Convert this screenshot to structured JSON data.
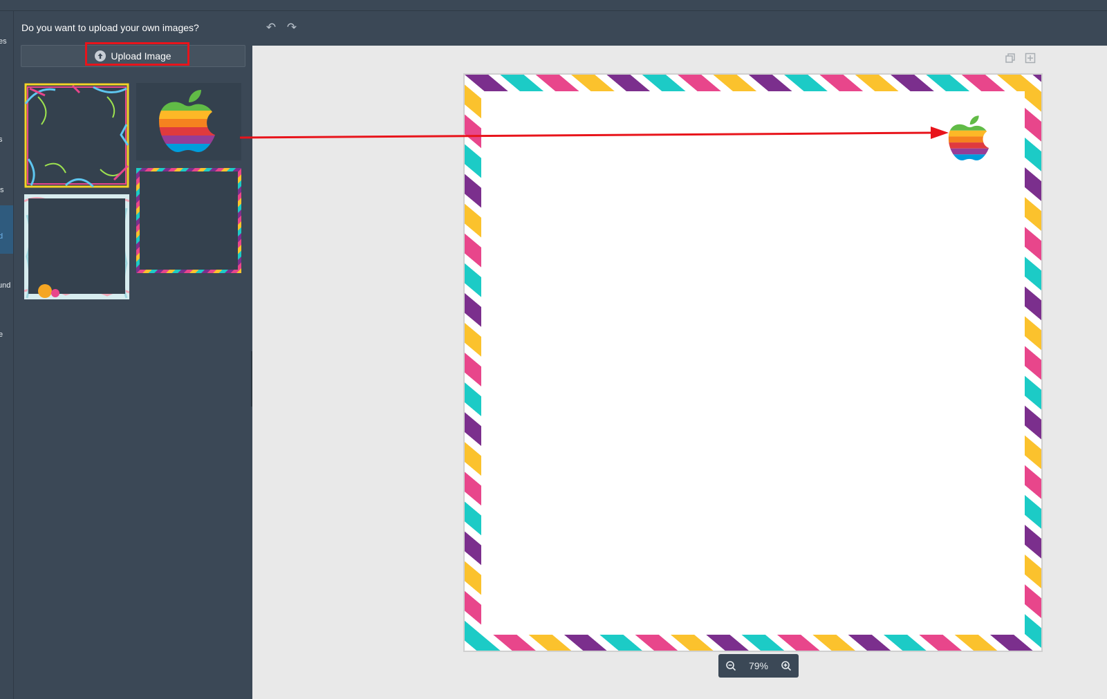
{
  "rail": {
    "items": [
      "es",
      "s",
      "ts",
      "d",
      "und",
      "e"
    ],
    "active_index": 3
  },
  "panel": {
    "question": "Do you want to upload your own images?",
    "upload_label": "Upload Image",
    "thumbnails": [
      "doodle-frame",
      "rainbow-apple-logo",
      "floral-frame",
      "striped-frame"
    ]
  },
  "toolbar": {
    "undo_icon": "undo-icon",
    "redo_icon": "redo-icon"
  },
  "workspace": {
    "zoom_level": "79%",
    "stripe_colors": [
      "#7b2f8d",
      "#1ccbc6",
      "#e8468b",
      "#fbc22d"
    ]
  },
  "colors": {
    "highlight": "#e8141b",
    "panel_bg": "#3b4856",
    "workspace_bg": "#e9e9e9"
  }
}
